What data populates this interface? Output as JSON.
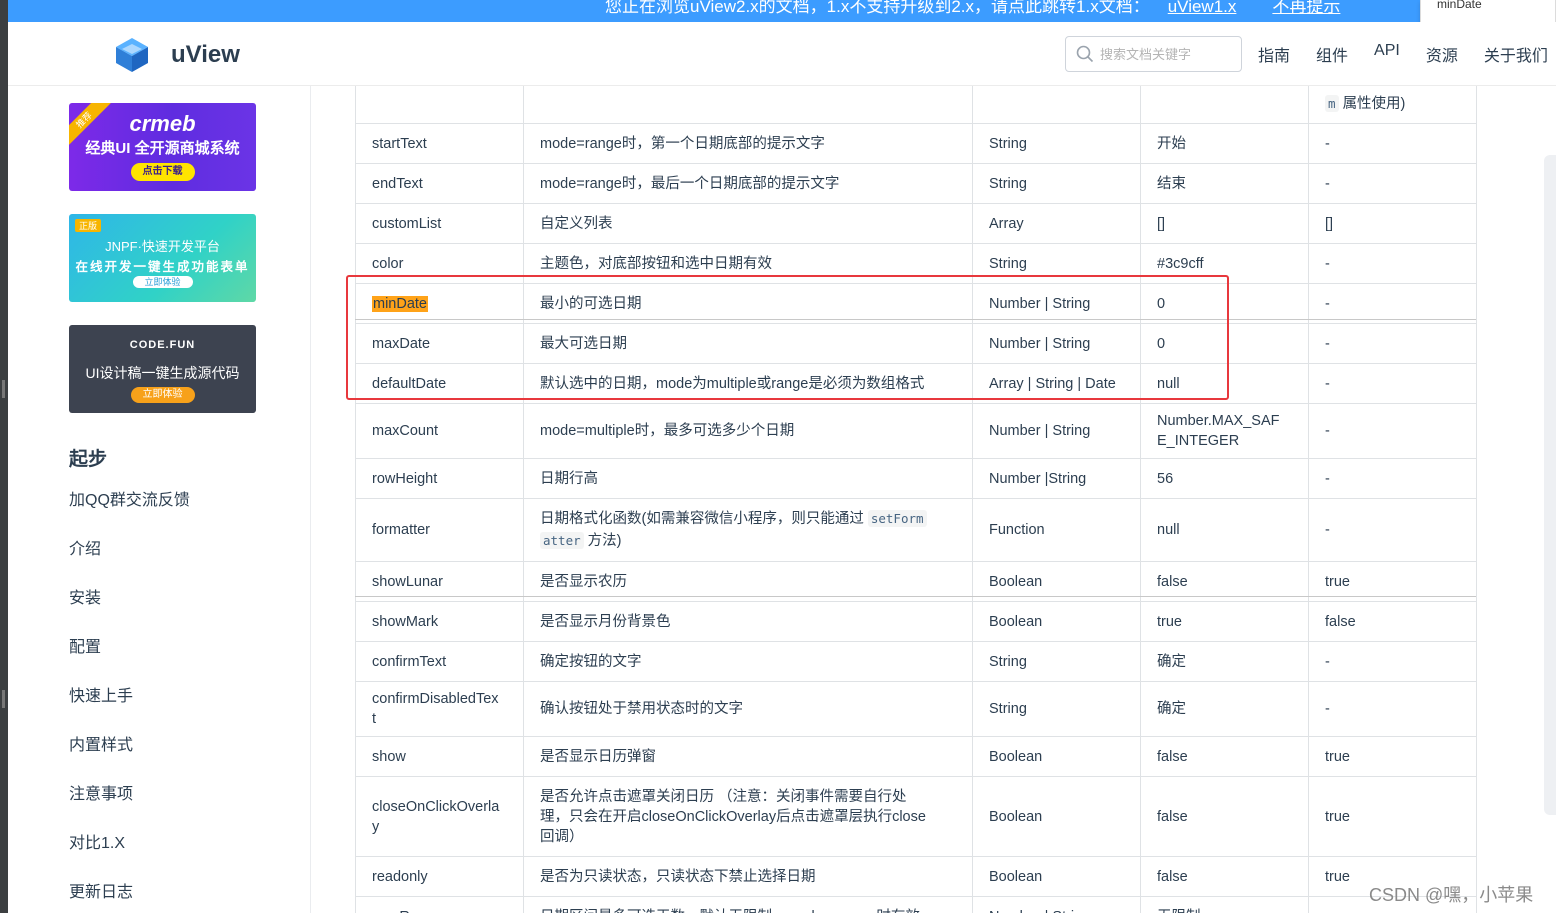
{
  "banner": {
    "text": "您正在浏览uView2.x的文档，1.x不支持升级到2.x，请点此跳转1.x文档：",
    "link": "uView1.x",
    "dismiss": "不再提示"
  },
  "popup": {
    "text": "minDate"
  },
  "header": {
    "brand": "uView",
    "search_placeholder": "搜索文档关键字",
    "nav": [
      "指南",
      "组件",
      "API",
      "资源",
      "关于我们"
    ]
  },
  "sidebar": {
    "ads": [
      {
        "ribbon": "推荐",
        "logo": "crmeb",
        "line": "经典UI  全开源商城系统",
        "cta": "点击下载"
      },
      {
        "badge": "正版",
        "logo": "JNPF·快速开发平台",
        "line": "在线开发一键生成功能表单",
        "cta": "立即体验"
      },
      {
        "logo": "CODE.FUN",
        "line": "UI设计稿一键生成源代码",
        "cta": "立即体验"
      }
    ],
    "group": "起步",
    "items": [
      "加QQ群交流反馈",
      "介绍",
      "安装",
      "配置",
      "快速上手",
      "内置样式",
      "注意事项",
      "对比1.X",
      "更新日志"
    ]
  },
  "table": {
    "rows": [
      {
        "name": "",
        "desc": "",
        "type": "",
        "default": "",
        "options": "属性使用)",
        "options_code": "m"
      },
      {
        "name": "startText",
        "desc": "mode=range时，第一个日期底部的提示文字",
        "type": "String",
        "default": "开始",
        "options": "-"
      },
      {
        "name": "endText",
        "desc": "mode=range时，最后一个日期底部的提示文字",
        "type": "String",
        "default": "结束",
        "options": "-"
      },
      {
        "name": "customList",
        "desc": "自定义列表",
        "type": "Array",
        "default": "[]",
        "options": "[]"
      },
      {
        "name": "color",
        "desc": "主题色，对底部按钮和选中日期有效",
        "type": "String",
        "default": "#3c9cff",
        "options": "-"
      },
      {
        "name": "minDate",
        "desc": "最小的可选日期",
        "type": "Number | String",
        "default": "0",
        "options": "-"
      },
      {
        "name": "maxDate",
        "desc": "最大可选日期",
        "type": "Number | String",
        "default": "0",
        "options": "-"
      },
      {
        "name": "defaultDate",
        "desc": "默认选中的日期，mode为multiple或range是必须为数组格式",
        "type": "Array | String | Date",
        "default": "null",
        "options": "-"
      },
      {
        "name": "maxCount",
        "desc": "mode=multiple时，最多可选多少个日期",
        "type": "Number | String",
        "default": "Number.MAX_SAF",
        "default2": "E_INTEGER",
        "options": "-"
      },
      {
        "name": "rowHeight",
        "desc": "日期行高",
        "type": "Number |String",
        "default": "56",
        "options": "-"
      },
      {
        "name": "formatter",
        "desc": "日期格式化函数(如需兼容微信小程序，则只能通过",
        "desc_code1": "setForm",
        "desc_code2": "atter",
        "desc_tail": "方法)",
        "type": "Function",
        "default": "null",
        "options": "-"
      },
      {
        "name": "showLunar",
        "desc": "是否显示农历",
        "type": "Boolean",
        "default": "false",
        "options": "true"
      },
      {
        "name": "showMark",
        "desc": "是否显示月份背景色",
        "type": "Boolean",
        "default": "true",
        "options": "false"
      },
      {
        "name": "confirmText",
        "desc": "确定按钮的文字",
        "type": "String",
        "default": "确定",
        "options": "-"
      },
      {
        "name": "confirmDisabledTex",
        "name2": "t",
        "desc": "确认按钮处于禁用状态时的文字",
        "type": "String",
        "default": "确定",
        "options": "-"
      },
      {
        "name": "show",
        "desc": "是否显示日历弹窗",
        "type": "Boolean",
        "default": "false",
        "options": "true"
      },
      {
        "name": "closeOnClickOverla",
        "name2": "y",
        "desc": "是否允许点击遮罩关闭日历 （注意：关闭事件需要自行处",
        "desc2": "理，只会在开启closeOnClickOverlay后点击遮罩层执行close",
        "desc3": "回调）",
        "type": "Boolean",
        "default": "false",
        "options": "true"
      },
      {
        "name": "readonly",
        "desc": "是否为只读状态，只读状态下禁止选择日期",
        "type": "Boolean",
        "default": "false",
        "options": "true"
      },
      {
        "name": "maxRange",
        "desc": "日期区间最多可选天数，默认无限制，mode = range时有效",
        "type": "Number | String",
        "default": "无限制",
        "options": "-"
      }
    ]
  },
  "watermark": "CSDN @嘿，小苹果"
}
